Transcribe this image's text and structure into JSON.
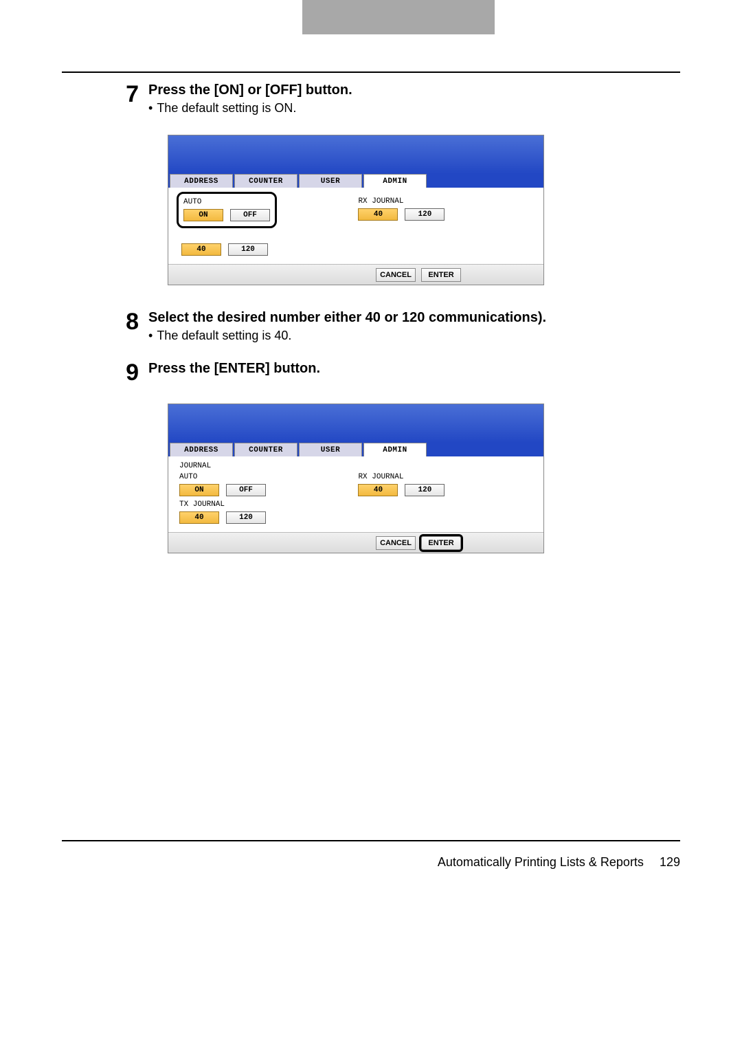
{
  "steps": {
    "s7": {
      "num": "7",
      "title": "Press the [ON] or [OFF] button.",
      "note": "The default setting is ON."
    },
    "s8": {
      "num": "8",
      "title": "Select the desired number either 40 or 120 communications).",
      "note": "The default setting is 40."
    },
    "s9": {
      "num": "9",
      "title": "Press the [ENTER] button."
    }
  },
  "screen": {
    "tabs": {
      "address": "ADDRESS",
      "counter": "COUNTER",
      "user": "USER",
      "admin": "ADMIN"
    },
    "labels": {
      "journal": "JOURNAL",
      "auto": "AUTO",
      "tx_journal": "TX JOURNAL",
      "rx_journal": "RX JOURNAL"
    },
    "buttons": {
      "on": "ON",
      "off": "OFF",
      "b40": "40",
      "b120": "120",
      "cancel": "CANCEL",
      "enter": "ENTER"
    }
  },
  "footer": {
    "title": "Automatically Printing Lists & Reports",
    "page": "129"
  }
}
